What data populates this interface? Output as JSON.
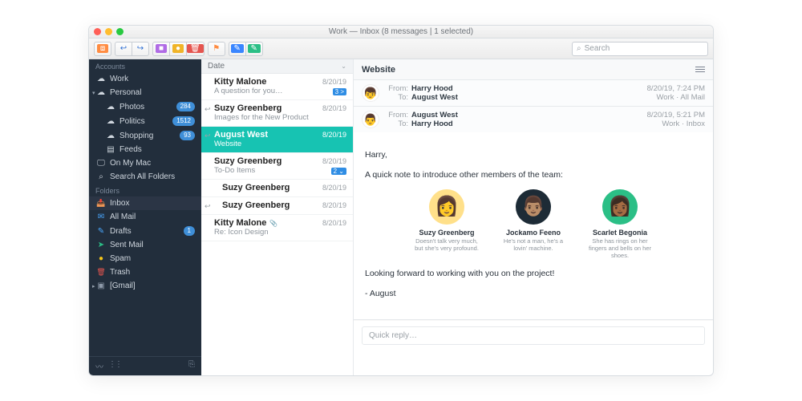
{
  "window_title": "Work — Inbox (8 messages | 1 selected)",
  "search": {
    "placeholder": "Search"
  },
  "sidebar": {
    "section_accounts": "Accounts",
    "section_folders": "Folders",
    "accounts": [
      {
        "label": "Work",
        "icon": "cloud"
      },
      {
        "label": "Personal",
        "icon": "cloud",
        "children": [
          {
            "label": "Photos",
            "icon": "cloud",
            "badge": "284"
          },
          {
            "label": "Politics",
            "icon": "cloud",
            "badge": "1512"
          },
          {
            "label": "Shopping",
            "icon": "cloud",
            "badge": "93"
          },
          {
            "label": "Feeds",
            "icon": "rss"
          }
        ]
      },
      {
        "label": "On My Mac",
        "icon": "monitor"
      },
      {
        "label": "Search All Folders",
        "icon": "search"
      }
    ],
    "folders": [
      {
        "label": "Inbox",
        "icon": "inbox",
        "color": "#ff9f40",
        "selected": true
      },
      {
        "label": "All Mail",
        "icon": "envelope",
        "color": "#4aa8ff"
      },
      {
        "label": "Drafts",
        "icon": "pencil",
        "color": "#4aa8ff",
        "badge": "1"
      },
      {
        "label": "Sent Mail",
        "icon": "plane",
        "color": "#2bbf86"
      },
      {
        "label": "Spam",
        "icon": "bang",
        "color": "#f5c518"
      },
      {
        "label": "Trash",
        "icon": "trash",
        "color": "#e5554f"
      },
      {
        "label": "[Gmail]",
        "icon": "folder",
        "color": "#8d99a8",
        "expandable": true
      }
    ]
  },
  "list": {
    "header": "Date",
    "messages": [
      {
        "from": "Kitty Malone",
        "subject": "A question for you…",
        "date": "8/20/19",
        "tag": {
          "text": "3 >",
          "color": "#2f8de4"
        }
      },
      {
        "from": "Suzy Greenberg",
        "subject": "Images for the New Product",
        "date": "8/20/19",
        "reply": true
      },
      {
        "from": "August West",
        "subject": "Website",
        "date": "8/20/19",
        "selected": true,
        "reply": true
      },
      {
        "from": "Suzy Greenberg",
        "subject": "To-Do Items",
        "date": "8/20/19",
        "tag": {
          "text": "2 ⌄",
          "color": "#2f8de4"
        }
      },
      {
        "from": "Suzy Greenberg",
        "subject": "",
        "date": "8/20/19",
        "child": true
      },
      {
        "from": "Suzy Greenberg",
        "subject": "",
        "date": "8/20/19",
        "child": true,
        "reply": true
      },
      {
        "from": "Kitty Malone",
        "subject": "Re: Icon Design",
        "date": "8/20/19",
        "attach": true
      }
    ]
  },
  "reader": {
    "subject": "Website",
    "threads": [
      {
        "from": "Harry Hood",
        "to": "August West",
        "date": "8/20/19, 7:24 PM",
        "folder": "Work · All Mail",
        "avatar_bg": "#fff",
        "avatar": "👦"
      },
      {
        "from": "August West",
        "to": "Harry Hood",
        "date": "8/20/19, 5:21 PM",
        "folder": "Work · Inbox",
        "avatar_bg": "#fff",
        "avatar": "👨",
        "expanded": true
      }
    ],
    "body": {
      "greeting": "Harry,",
      "intro": "A quick note to introduce other members of the team:",
      "members": [
        {
          "name": "Suzy Greenberg",
          "bio": "Doesn't talk very much, but she's very profound.",
          "bg": "#ffe08a",
          "emoji": "👩"
        },
        {
          "name": "Jockamo Feeno",
          "bio": "He's not a man, he's a lovin' machine.",
          "bg": "#1d2b36",
          "emoji": "👨🏽"
        },
        {
          "name": "Scarlet Begonia",
          "bio": "She has rings on her fingers and bells on her shoes.",
          "bg": "#2bbf86",
          "emoji": "👩🏾"
        }
      ],
      "closing1": "Looking forward to working with you on the project!",
      "closing2": "- August"
    },
    "quick_reply": "Quick reply…"
  },
  "toolbar_icons": [
    {
      "name": "archive-button",
      "glyph": "⧈",
      "bg": "#ff8c42"
    },
    {
      "name": "reply-button",
      "glyph": "↩",
      "fg": "#2f6fd3"
    },
    {
      "name": "reply-all-button",
      "glyph": "↪",
      "fg": "#2f6fd3"
    },
    {
      "name": "purple-button",
      "glyph": "■",
      "bg": "#b06be5"
    },
    {
      "name": "yellow-button",
      "glyph": "●",
      "bg": "#f0b429"
    },
    {
      "name": "delete-button",
      "glyph": "🗑",
      "bg": "#e5554f"
    },
    {
      "name": "flag-button",
      "glyph": "⚑",
      "fg": "#ff8c42"
    },
    {
      "name": "edit-button",
      "glyph": "✎",
      "bg": "#3a86ff"
    },
    {
      "name": "compose-button",
      "glyph": "✎",
      "bg": "#2bbf86"
    }
  ]
}
